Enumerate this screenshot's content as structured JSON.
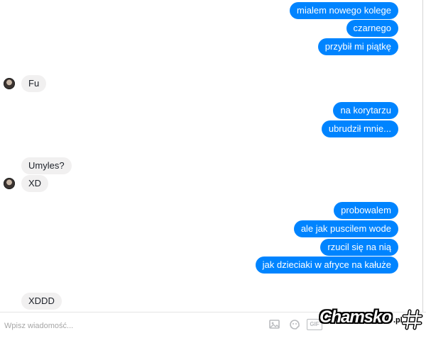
{
  "thread": {
    "messages": [
      {
        "id": "m1",
        "side": "out",
        "text": "mialem nowego kolege"
      },
      {
        "id": "m2",
        "side": "out",
        "text": "czarnego"
      },
      {
        "id": "m3",
        "side": "out",
        "text": "przybił mi piątkę"
      },
      {
        "id": "m4",
        "side": "in",
        "text": "Fu"
      },
      {
        "id": "m5",
        "side": "out",
        "text": "na korytarzu"
      },
      {
        "id": "m6",
        "side": "out",
        "text": "ubrudził mnie..."
      },
      {
        "id": "m7",
        "side": "in",
        "text": "Umyles?"
      },
      {
        "id": "m8",
        "side": "in",
        "text": "XD"
      },
      {
        "id": "m9",
        "side": "out",
        "text": "probowalem"
      },
      {
        "id": "m10",
        "side": "out",
        "text": "ale jak puscilem wode"
      },
      {
        "id": "m11",
        "side": "out",
        "text": "rzucil się na nią"
      },
      {
        "id": "m12",
        "side": "out",
        "text": "jak dzieciaki w afryce na kałuże"
      },
      {
        "id": "m13",
        "side": "in",
        "text": "XDDD"
      }
    ]
  },
  "composer": {
    "placeholder": "Wpisz wiadomość...",
    "icons": [
      "image-icon",
      "sticker-icon",
      "gif-icon"
    ],
    "gif_label": "GIF"
  },
  "watermark": {
    "text": "Chamsko",
    "suffix": ".pl"
  },
  "colors": {
    "outgoing_bubble": "#0084ff",
    "incoming_bubble": "#f1f0f0"
  }
}
